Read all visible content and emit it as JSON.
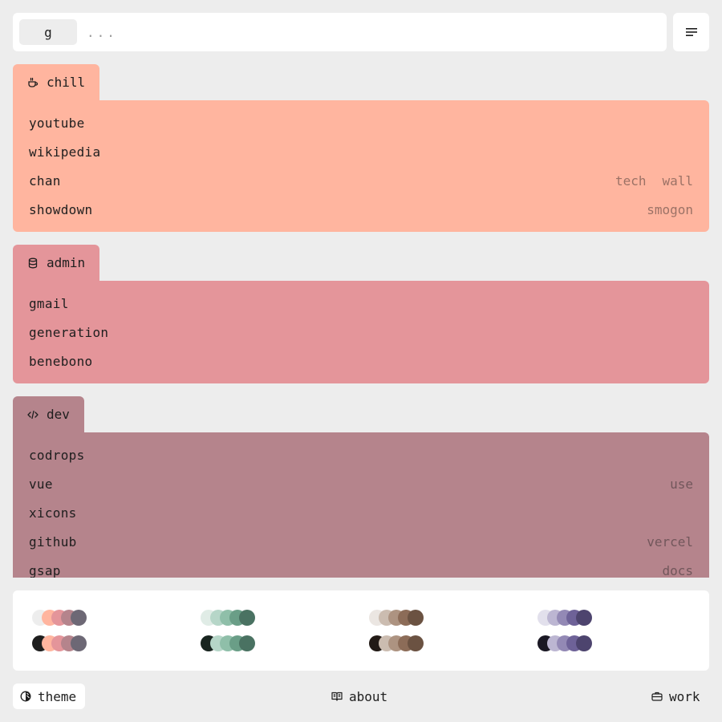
{
  "search": {
    "engine_key": "g",
    "placeholder": "...",
    "value": ""
  },
  "menu": {
    "icon": "menu-lines-icon"
  },
  "groups": [
    {
      "name": "chill",
      "icon": "coffee-cup-icon",
      "color": "#ffb59f",
      "links": [
        {
          "label": "youtube",
          "subs": []
        },
        {
          "label": "wikipedia",
          "subs": []
        },
        {
          "label": "chan",
          "subs": [
            "tech",
            "wall"
          ]
        },
        {
          "label": "showdown",
          "subs": [
            "smogon"
          ]
        }
      ]
    },
    {
      "name": "admin",
      "icon": "database-icon",
      "color": "#e4959a",
      "links": [
        {
          "label": "gmail",
          "subs": []
        },
        {
          "label": "generation",
          "subs": []
        },
        {
          "label": "benebono",
          "subs": []
        }
      ]
    },
    {
      "name": "dev",
      "icon": "code-icon",
      "color": "#b5848c",
      "links": [
        {
          "label": "codrops",
          "subs": []
        },
        {
          "label": "vue",
          "subs": [
            "use"
          ]
        },
        {
          "label": "xicons",
          "subs": []
        },
        {
          "label": "github",
          "subs": [
            "vercel"
          ]
        },
        {
          "label": "gsap",
          "subs": [
            "docs"
          ]
        }
      ]
    }
  ],
  "palettes": [
    {
      "light": [
        "#ededed",
        "#ffb59f",
        "#e4959a",
        "#b5848c",
        "#6d6875"
      ],
      "dark": [
        "#1e1e1e",
        "#ffb59f",
        "#e4959a",
        "#b5848c",
        "#6d6875"
      ]
    },
    {
      "light": [
        "#e0ece6",
        "#b6d6c8",
        "#8fbfa9",
        "#6a9e87",
        "#4a7262"
      ],
      "dark": [
        "#18241f",
        "#b6d6c8",
        "#8fbfa9",
        "#6a9e87",
        "#4a7262"
      ]
    },
    {
      "light": [
        "#ebe6e2",
        "#cbbcb0",
        "#ad9381",
        "#8c6c58",
        "#6b5242"
      ],
      "dark": [
        "#221a16",
        "#cbbcb0",
        "#ad9381",
        "#8c6c58",
        "#6b5242"
      ]
    },
    {
      "light": [
        "#e2e0ec",
        "#bcb6d2",
        "#9389b5",
        "#6e6298",
        "#4d446e"
      ],
      "dark": [
        "#1a1824",
        "#bcb6d2",
        "#9389b5",
        "#6e6298",
        "#4d446e"
      ]
    }
  ],
  "footer": {
    "theme_label": "theme",
    "about_label": "about",
    "work_label": "work"
  }
}
